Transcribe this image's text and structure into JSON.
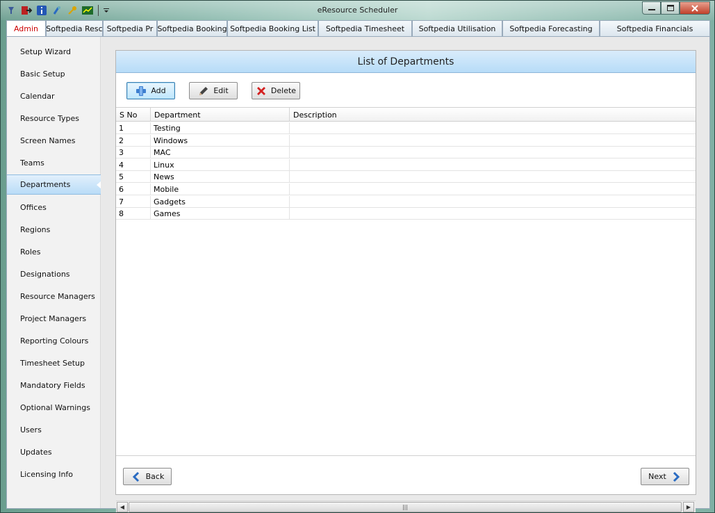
{
  "window": {
    "title": "eResource Scheduler",
    "quick_access": [
      "pin-icon",
      "exit-icon",
      "info-icon",
      "help-icon",
      "key-icon",
      "chart-icon",
      "dropdown-icon"
    ]
  },
  "tabs": [
    {
      "label": "Admin",
      "active": true
    },
    {
      "label": "Softpedia Resc"
    },
    {
      "label": "Softpedia Pr"
    },
    {
      "label": "Softpedia Booking"
    },
    {
      "label": "Softpedia Booking List"
    },
    {
      "label": "Softpedia Timesheet"
    },
    {
      "label": "Softpedia Utilisation"
    },
    {
      "label": "Softpedia Forecasting"
    },
    {
      "label": "Softpedia Financials"
    }
  ],
  "sidebar": {
    "items": [
      {
        "label": "Setup Wizard"
      },
      {
        "label": "Basic Setup"
      },
      {
        "label": "Calendar"
      },
      {
        "label": "Resource Types"
      },
      {
        "label": "Screen Names"
      },
      {
        "label": "Teams"
      },
      {
        "label": "Departments",
        "active": true
      },
      {
        "label": "Offices"
      },
      {
        "label": "Regions"
      },
      {
        "label": "Roles"
      },
      {
        "label": "Designations"
      },
      {
        "label": "Resource Managers"
      },
      {
        "label": "Project Managers"
      },
      {
        "label": "Reporting Colours"
      },
      {
        "label": "Timesheet Setup"
      },
      {
        "label": "Mandatory Fields"
      },
      {
        "label": "Optional Warnings"
      },
      {
        "label": "Users"
      },
      {
        "label": "Updates"
      },
      {
        "label": "Licensing Info"
      }
    ]
  },
  "panel": {
    "title": "List of Departments",
    "add_label": "Add",
    "edit_label": "Edit",
    "delete_label": "Delete",
    "back_label": "Back",
    "next_label": "Next",
    "columns": [
      "S No",
      "Department",
      "Description"
    ],
    "rows": [
      {
        "sno": "1",
        "department": "Testing",
        "description": ""
      },
      {
        "sno": "2",
        "department": "Windows",
        "description": ""
      },
      {
        "sno": "3",
        "department": "MAC",
        "description": ""
      },
      {
        "sno": "4",
        "department": "Linux",
        "description": ""
      },
      {
        "sno": "5",
        "department": "News",
        "description": ""
      },
      {
        "sno": "6",
        "department": "Mobile",
        "description": ""
      },
      {
        "sno": "7",
        "department": "Gadgets",
        "description": ""
      },
      {
        "sno": "8",
        "department": "Games",
        "description": ""
      }
    ]
  },
  "colors": {
    "accent_tab_text": "#cc0000",
    "header_blue": "#b7dcf8",
    "selection_blue": "#b9dcf7"
  }
}
